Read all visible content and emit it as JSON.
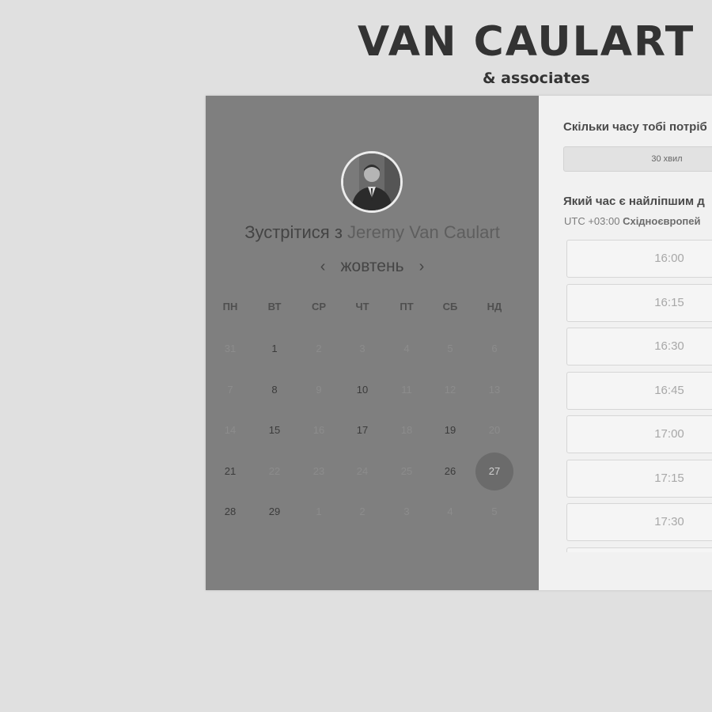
{
  "brand": {
    "name": "VAN CAULART",
    "sub": "& associates"
  },
  "profile": {
    "title_prefix": "Зустрітися з",
    "host_name": "Jeremy Van Caulart"
  },
  "calendar": {
    "month": "жовтень",
    "prev_arrow": "‹",
    "next_arrow": "›",
    "weekdays": [
      "ПН",
      "ВТ",
      "СР",
      "ЧТ",
      "ПТ",
      "СБ",
      "НД"
    ],
    "weeks": [
      [
        {
          "d": "31",
          "s": "muted"
        },
        {
          "d": "1",
          "s": "avail"
        },
        {
          "d": "2",
          "s": "muted"
        },
        {
          "d": "3",
          "s": "muted"
        },
        {
          "d": "4",
          "s": "muted"
        },
        {
          "d": "5",
          "s": "muted"
        },
        {
          "d": "6",
          "s": "muted"
        }
      ],
      [
        {
          "d": "7",
          "s": "muted"
        },
        {
          "d": "8",
          "s": "avail"
        },
        {
          "d": "9",
          "s": "muted"
        },
        {
          "d": "10",
          "s": "avail"
        },
        {
          "d": "11",
          "s": "muted"
        },
        {
          "d": "12",
          "s": "muted"
        },
        {
          "d": "13",
          "s": "muted"
        }
      ],
      [
        {
          "d": "14",
          "s": "muted"
        },
        {
          "d": "15",
          "s": "avail"
        },
        {
          "d": "16",
          "s": "muted"
        },
        {
          "d": "17",
          "s": "avail"
        },
        {
          "d": "18",
          "s": "muted"
        },
        {
          "d": "19",
          "s": "avail"
        },
        {
          "d": "20",
          "s": "muted"
        }
      ],
      [
        {
          "d": "21",
          "s": "avail"
        },
        {
          "d": "22",
          "s": "muted"
        },
        {
          "d": "23",
          "s": "muted"
        },
        {
          "d": "24",
          "s": "muted"
        },
        {
          "d": "25",
          "s": "muted"
        },
        {
          "d": "26",
          "s": "avail"
        },
        {
          "d": "27",
          "s": "selected"
        }
      ],
      [
        {
          "d": "28",
          "s": "avail"
        },
        {
          "d": "29",
          "s": "avail"
        },
        {
          "d": "1",
          "s": "muted"
        },
        {
          "d": "2",
          "s": "muted"
        },
        {
          "d": "3",
          "s": "muted"
        },
        {
          "d": "4",
          "s": "muted"
        },
        {
          "d": "5",
          "s": "muted"
        }
      ]
    ]
  },
  "booking": {
    "duration_question": "Скільки часу тобі потріб",
    "duration_option": "30 хвил",
    "time_question": "Який час є найліпшим д",
    "timezone_offset": "UTC +03:00",
    "timezone_name": "Східноєвропей",
    "slots": [
      "16:00",
      "16:15",
      "16:30",
      "16:45",
      "17:00",
      "17:15",
      "17:30",
      ""
    ]
  },
  "colors": {
    "page_bg": "#e0e0e0",
    "left_panel_bg": "#7f7f7f",
    "selected_day_bg": "#6b6b6b",
    "right_panel_bg": "#f1f1f1"
  }
}
